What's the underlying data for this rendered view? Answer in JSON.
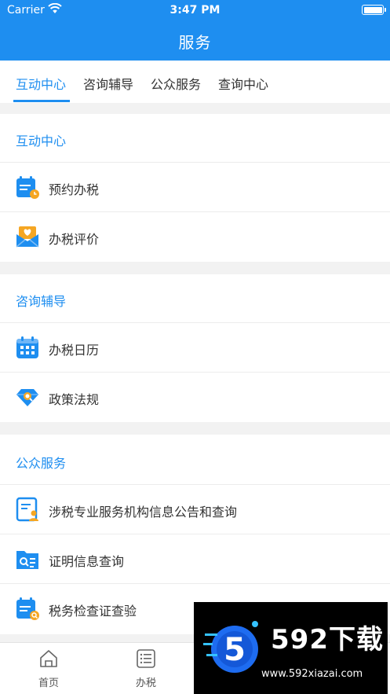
{
  "status": {
    "carrier": "Carrier",
    "time": "3:47 PM"
  },
  "header": {
    "title": "服务"
  },
  "tabs": [
    {
      "label": "互动中心",
      "active": true
    },
    {
      "label": "咨询辅导",
      "active": false
    },
    {
      "label": "公众服务",
      "active": false
    },
    {
      "label": "查询中心",
      "active": false
    }
  ],
  "sections": [
    {
      "title": "互动中心",
      "items": [
        {
          "label": "预约办税",
          "icon": "calendar-clock-icon"
        },
        {
          "label": "办税评价",
          "icon": "heart-envelope-icon"
        }
      ]
    },
    {
      "title": "咨询辅导",
      "items": [
        {
          "label": "办税日历",
          "icon": "calendar-grid-icon"
        },
        {
          "label": "政策法规",
          "icon": "diamond-search-icon"
        }
      ]
    },
    {
      "title": "公众服务",
      "items": [
        {
          "label": "涉税专业服务机构信息公告和查询",
          "icon": "document-person-icon"
        },
        {
          "label": "证明信息查询",
          "icon": "folder-search-icon"
        },
        {
          "label": "税务检查证查验",
          "icon": "calendar-search-icon"
        }
      ]
    }
  ],
  "tabbar": [
    {
      "label": "首页",
      "icon": "home-icon"
    },
    {
      "label": "办税",
      "icon": "list-icon"
    }
  ],
  "watermark": {
    "brand": "592下载",
    "url": "www.592xiazai.com"
  },
  "colors": {
    "primary": "#1e8ef0",
    "orange": "#f5a623",
    "text": "#333333"
  }
}
